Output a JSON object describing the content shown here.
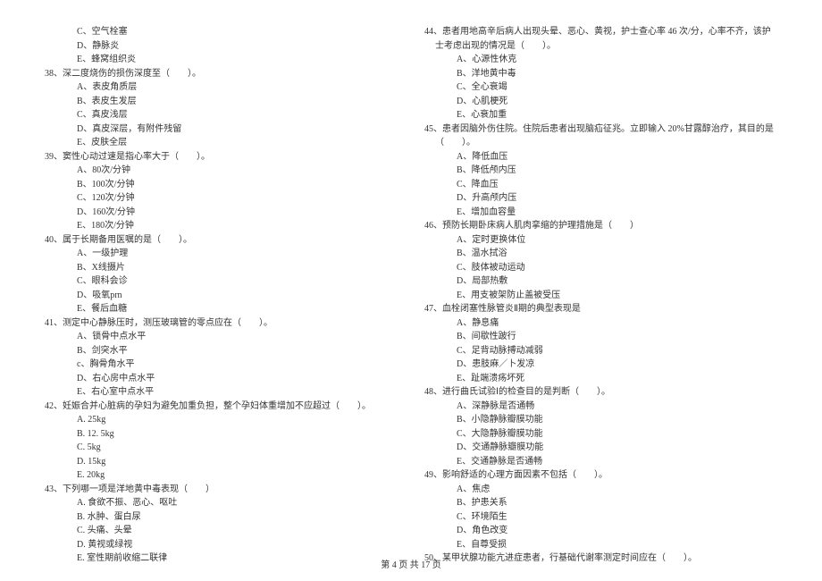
{
  "footer": "第 4 页 共 17 页",
  "left": [
    {
      "t": "opt",
      "v": "C、空气栓塞"
    },
    {
      "t": "opt",
      "v": "D、静脉炎"
    },
    {
      "t": "opt",
      "v": "E、蜂窝组织炎"
    },
    {
      "t": "q",
      "v": "38、深二度烧伤的损伤深度至（　　）。"
    },
    {
      "t": "opt",
      "v": "A、表皮角质层"
    },
    {
      "t": "opt",
      "v": "B、表皮生发层"
    },
    {
      "t": "opt",
      "v": "C、真皮浅层"
    },
    {
      "t": "opt",
      "v": "D、真皮深层，有附件残留"
    },
    {
      "t": "opt",
      "v": "E、皮肤全层"
    },
    {
      "t": "q",
      "v": "39、窦性心动过速是指心率大于（　　）。"
    },
    {
      "t": "opt",
      "v": "A、80次/分钟"
    },
    {
      "t": "opt",
      "v": "B、100次/分钟"
    },
    {
      "t": "opt",
      "v": "C、120次/分钟"
    },
    {
      "t": "opt",
      "v": "D、160次/分钟"
    },
    {
      "t": "opt",
      "v": "E、180次/分钟"
    },
    {
      "t": "q",
      "v": "40、属于长期备用医嘱的是（　　）。"
    },
    {
      "t": "opt",
      "v": "A、一级护理"
    },
    {
      "t": "opt",
      "v": "B、X线摄片"
    },
    {
      "t": "opt",
      "v": "C、眼科会诊"
    },
    {
      "t": "opt",
      "v": "D、吸氧prn"
    },
    {
      "t": "opt",
      "v": "E、餐后血糖"
    },
    {
      "t": "q",
      "v": "41、测定中心静脉压时，测压玻璃管的零点应在（　　）。"
    },
    {
      "t": "opt",
      "v": "A、锁骨中点水平"
    },
    {
      "t": "opt",
      "v": "B、剑突水平"
    },
    {
      "t": "opt",
      "v": "c、胸骨角水平"
    },
    {
      "t": "opt",
      "v": "D、右心房中点水平"
    },
    {
      "t": "opt",
      "v": "E、右心室中点水平"
    },
    {
      "t": "q",
      "v": "42、妊娠合并心脏病的孕妇为避免加重负担，整个孕妇体重增加不应超过（　　）。"
    },
    {
      "t": "opt",
      "v": "A. 25kg"
    },
    {
      "t": "opt",
      "v": "B. 12. 5kg"
    },
    {
      "t": "opt",
      "v": "C. 5kg"
    },
    {
      "t": "opt",
      "v": "D. 15kg"
    },
    {
      "t": "opt",
      "v": "E. 20kg"
    },
    {
      "t": "q",
      "v": "43、下列哪一项是洋地黄中毒表现（　　）"
    },
    {
      "t": "opt",
      "v": "A. 食欲不振、恶心、呕吐"
    },
    {
      "t": "opt",
      "v": "B. 水肿、蛋白尿"
    },
    {
      "t": "opt",
      "v": "C. 头痛、头晕"
    },
    {
      "t": "opt",
      "v": "D. 黄视或绿视"
    },
    {
      "t": "opt",
      "v": "E. 室性期前收缩二联律"
    }
  ],
  "right": [
    {
      "t": "q",
      "v": "44、患者用地高辛后病人出现头晕、恶心、黄视，护士查心率 46 次/分，心率不齐，该护士考虑出现的情况是（　　）。"
    },
    {
      "t": "opt",
      "v": "A、心源性休克"
    },
    {
      "t": "opt",
      "v": "B、洋地黄中毒"
    },
    {
      "t": "opt",
      "v": "C、全心衰竭"
    },
    {
      "t": "opt",
      "v": "D、心肌梗死"
    },
    {
      "t": "opt",
      "v": "E、心衰加重"
    },
    {
      "t": "q",
      "v": "45、患者因脑外伤住院。住院后患者出现脑疝征兆。立即输入 20%甘露醇治疗，其目的是（　　）。"
    },
    {
      "t": "opt",
      "v": "A、降低血压"
    },
    {
      "t": "opt",
      "v": "B、降低颅内压"
    },
    {
      "t": "opt",
      "v": "C、降血压"
    },
    {
      "t": "opt",
      "v": "D、升高颅内压"
    },
    {
      "t": "opt",
      "v": "E、增加血容量"
    },
    {
      "t": "q",
      "v": "46、预防长期卧床病人肌肉挛缩的护理措施是（　　）"
    },
    {
      "t": "opt",
      "v": "A、定时更换体位"
    },
    {
      "t": "opt",
      "v": "B、温水拭浴"
    },
    {
      "t": "opt",
      "v": "C、肢体被动运动"
    },
    {
      "t": "opt",
      "v": "D、局部热敷"
    },
    {
      "t": "opt",
      "v": "E、用支被架防止盖被受压"
    },
    {
      "t": "q",
      "v": "47、血栓闭塞性脉管炎Ⅱ期的典型表现是"
    },
    {
      "t": "opt",
      "v": "A、静息痛"
    },
    {
      "t": "opt",
      "v": "B、间歇性跛行"
    },
    {
      "t": "opt",
      "v": "C、足背动脉搏动减弱"
    },
    {
      "t": "opt",
      "v": "D、患肢麻／卜发凉"
    },
    {
      "t": "opt",
      "v": "E、趾端溃疡坏死"
    },
    {
      "t": "q",
      "v": "48、进行曲氏试验Ⅰ的检查目的是判断（　　）。"
    },
    {
      "t": "opt",
      "v": "A、深静脉是否通畅"
    },
    {
      "t": "opt",
      "v": "B、小隐静脉瓣膜功能"
    },
    {
      "t": "opt",
      "v": "C、大隐静脉瓣膜功能"
    },
    {
      "t": "opt",
      "v": "D、交通静脉瓣膜功能"
    },
    {
      "t": "opt",
      "v": "E、交通静脉是否通畅"
    },
    {
      "t": "q",
      "v": "49、影响舒适的心理方面因素不包括（　　）。"
    },
    {
      "t": "opt",
      "v": "A、焦虑"
    },
    {
      "t": "opt",
      "v": "B、护患关系"
    },
    {
      "t": "opt",
      "v": "C、环境陌生"
    },
    {
      "t": "opt",
      "v": "D、角色改变"
    },
    {
      "t": "opt",
      "v": "E、自尊受损"
    },
    {
      "t": "q",
      "v": "50、某甲状腺功能亢进症患者，行基础代谢率测定时间应在（　　）。"
    }
  ]
}
